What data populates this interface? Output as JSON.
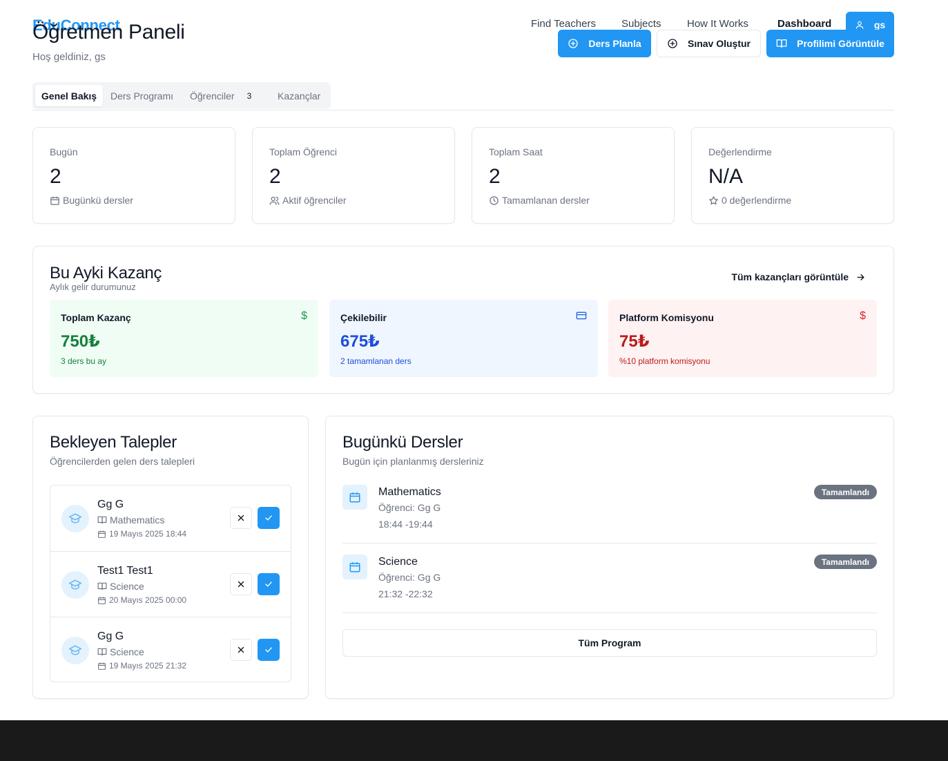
{
  "nav": {
    "brand": "EduConnect",
    "links": [
      "Find Teachers",
      "Subjects",
      "How It Works",
      "Dashboard"
    ],
    "user": "gs"
  },
  "header": {
    "title": "Öğretmen Paneli",
    "welcome": "Hoş geldiniz, gs",
    "actions": {
      "plan": "Ders Planla",
      "exam": "Sınav Oluştur",
      "profile": "Profilimi Görüntüle"
    }
  },
  "tabs": [
    {
      "label": "Genel Bakış",
      "active": true
    },
    {
      "label": "Ders Programı"
    },
    {
      "label": "Öğrenciler",
      "count": "3"
    },
    {
      "label": "Kazançlar"
    }
  ],
  "stats": [
    {
      "label": "Bugün",
      "value": "2",
      "sub": "Bugünkü dersler",
      "icon": "calendar-icon"
    },
    {
      "label": "Toplam Öğrenci",
      "value": "2",
      "sub": "Aktif öğrenciler",
      "icon": "users-icon"
    },
    {
      "label": "Toplam Saat",
      "value": "2",
      "sub": "Tamamlanan dersler",
      "icon": "clock-icon"
    },
    {
      "label": "Değerlendirme",
      "value": "N/A",
      "sub": "0 değerlendirme",
      "icon": "star-icon"
    }
  ],
  "earnings": {
    "title": "Bu Ayki Kazanç",
    "subtitle": "Aylık gelir durumunuz",
    "link": "Tüm kazançları görüntüle",
    "boxes": [
      {
        "label": "Toplam Kazanç",
        "value": "750₺",
        "note": "3 ders bu ay",
        "icon": "dollar-icon",
        "color": "#15803d",
        "bg": "#f0fdf4"
      },
      {
        "label": "Çekilebilir",
        "value": "675₺",
        "note": "2 tamamlanan ders",
        "icon": "credit-card-icon",
        "color": "#1d4ed8",
        "bg": "#eff6ff"
      },
      {
        "label": "Platform Komisyonu",
        "value": "75₺",
        "note": "%10 platform komisyonu",
        "icon": "dollar-icon",
        "color": "#b91c1c",
        "bg": "#fef2f2"
      }
    ]
  },
  "pending": {
    "title": "Bekleyen Talepler",
    "subtitle": "Öğrencilerden gelen ders talepleri",
    "requests": [
      {
        "name": "Gg G",
        "subject": "Mathematics",
        "date": "19 Mayıs 2025 18:44"
      },
      {
        "name": "Test1 Test1",
        "subject": "Science",
        "date": "20 Mayıs 2025 00:00"
      },
      {
        "name": "Gg G",
        "subject": "Science",
        "date": "19 Mayıs 2025 21:32"
      }
    ]
  },
  "today": {
    "title": "Bugünkü Dersler",
    "subtitle": "Bugün için planlanmış dersleriniz",
    "lessons": [
      {
        "subject": "Mathematics",
        "student": "Öğrenci: Gg G",
        "time": "18:44 -19:44",
        "status": "Tamamlandı"
      },
      {
        "subject": "Science",
        "student": "Öğrenci: Gg G",
        "time": "21:32 -22:32",
        "status": "Tamamlandı"
      }
    ],
    "all_button": "Tüm Program"
  },
  "colors": {
    "accent": "#2196f3",
    "footer": "#1a1a1a",
    "badge": "#6b7280"
  }
}
